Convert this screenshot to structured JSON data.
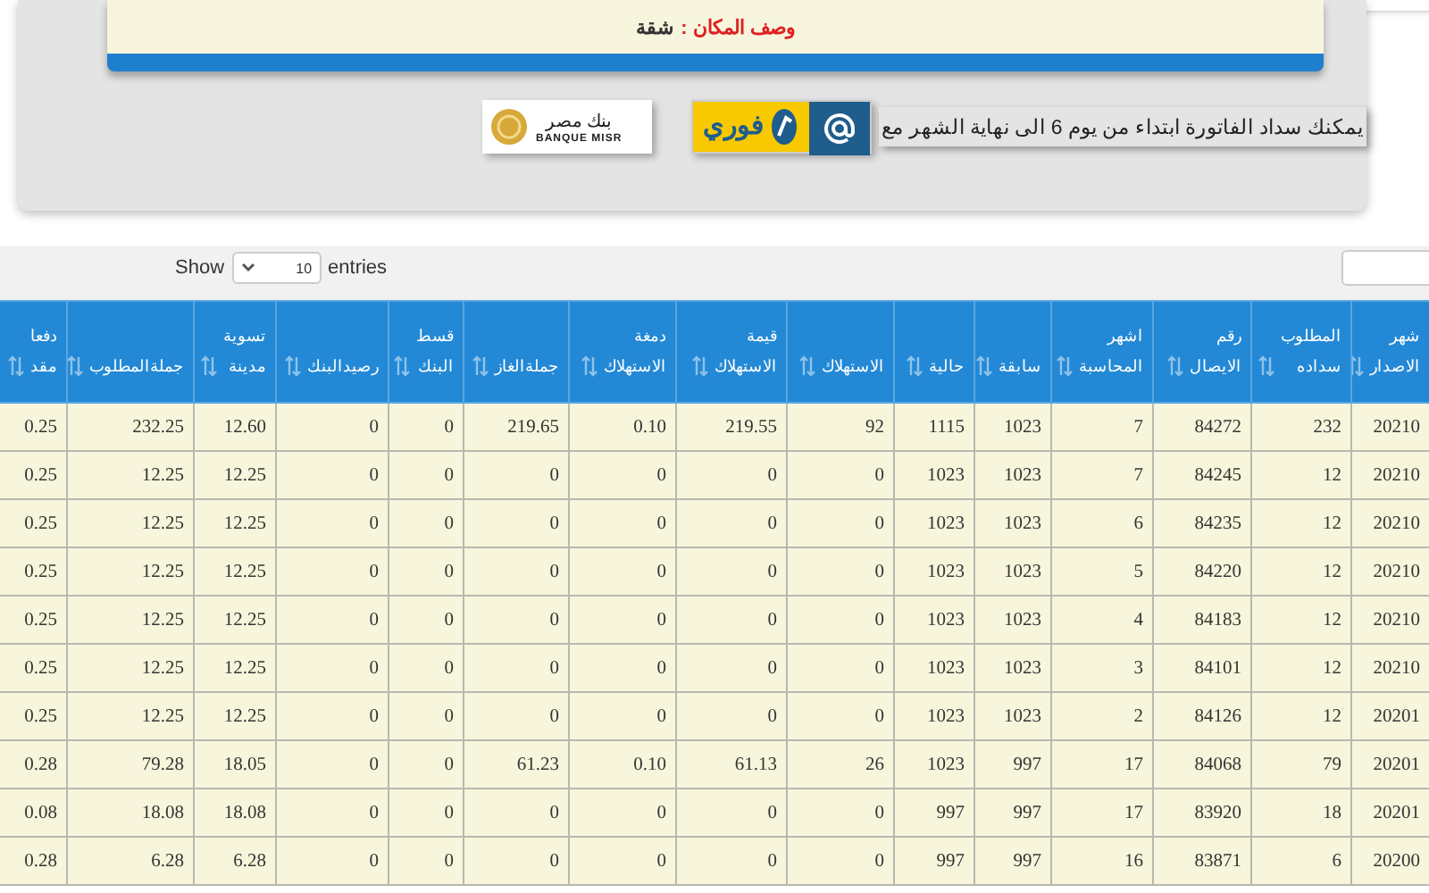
{
  "place": {
    "label": "وصف المكان :",
    "value": "شقة"
  },
  "payment_note": "يمكنك سداد الفاتورة ابتداء من يوم 6 الى نهاية الشهر مع",
  "logos": [
    {
      "kind": "bank",
      "texts": [
        "بنك مصر",
        "BANQUE MISR"
      ]
    },
    {
      "kind": "fawry",
      "texts": [
        "فوري"
      ]
    }
  ],
  "length_menu": {
    "before": "Show",
    "value": "10",
    "after": "entries"
  },
  "table": {
    "columns": [
      "دفعا\nمقد",
      "جملةالمطلوب",
      "تسوية\nمدينة",
      "رصيدالبنك",
      "قسط\nالبنك",
      "جملةالغاز",
      "دمغة\nالاستهلاك",
      "قيمة\nالاستهلاك",
      "الاستهلاك",
      "حالية",
      "سابقة",
      "اشهر\nالمحاسبة",
      "رقم\nالايصال",
      "المطلوب\nسداده",
      "شهر\nالاصدار"
    ],
    "rows": [
      [
        "0.25",
        "232.25",
        "12.60",
        "0",
        "0",
        "219.65",
        "0.10",
        "219.55",
        "92",
        "1115",
        "1023",
        "7",
        "84272",
        "232",
        "20210"
      ],
      [
        "0.25",
        "12.25",
        "12.25",
        "0",
        "0",
        "0",
        "0",
        "0",
        "0",
        "1023",
        "1023",
        "7",
        "84245",
        "12",
        "20210"
      ],
      [
        "0.25",
        "12.25",
        "12.25",
        "0",
        "0",
        "0",
        "0",
        "0",
        "0",
        "1023",
        "1023",
        "6",
        "84235",
        "12",
        "20210"
      ],
      [
        "0.25",
        "12.25",
        "12.25",
        "0",
        "0",
        "0",
        "0",
        "0",
        "0",
        "1023",
        "1023",
        "5",
        "84220",
        "12",
        "20210"
      ],
      [
        "0.25",
        "12.25",
        "12.25",
        "0",
        "0",
        "0",
        "0",
        "0",
        "0",
        "1023",
        "1023",
        "4",
        "84183",
        "12",
        "20210"
      ],
      [
        "0.25",
        "12.25",
        "12.25",
        "0",
        "0",
        "0",
        "0",
        "0",
        "0",
        "1023",
        "1023",
        "3",
        "84101",
        "12",
        "20210"
      ],
      [
        "0.25",
        "12.25",
        "12.25",
        "0",
        "0",
        "0",
        "0",
        "0",
        "0",
        "1023",
        "1023",
        "2",
        "84126",
        "12",
        "20201"
      ],
      [
        "0.28",
        "79.28",
        "18.05",
        "0",
        "0",
        "61.23",
        "0.10",
        "61.13",
        "26",
        "1023",
        "997",
        "17",
        "84068",
        "79",
        "20201"
      ],
      [
        "0.08",
        "18.08",
        "18.08",
        "0",
        "0",
        "0",
        "0",
        "0",
        "0",
        "997",
        "997",
        "17",
        "83920",
        "18",
        "20201"
      ],
      [
        "0.28",
        "6.28",
        "6.28",
        "0",
        "0",
        "0",
        "0",
        "0",
        "0",
        "997",
        "997",
        "16",
        "83871",
        "6",
        "20200"
      ]
    ]
  }
}
